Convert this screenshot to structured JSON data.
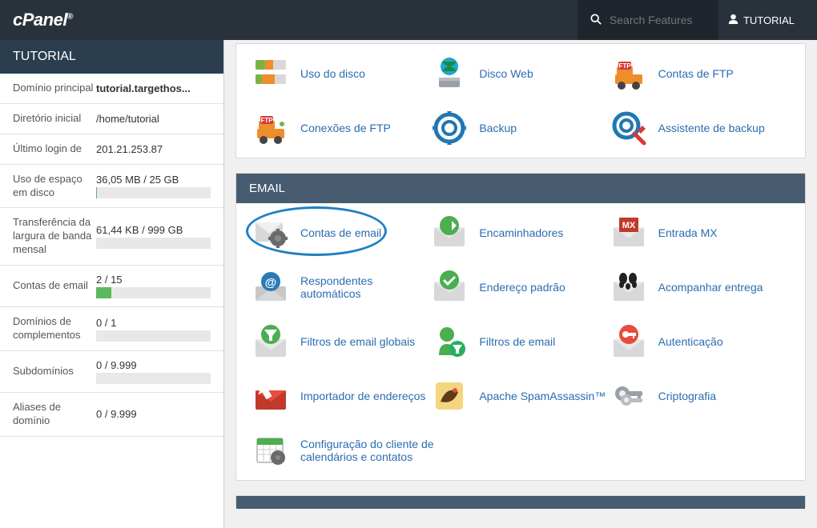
{
  "header": {
    "logo_text": "cPanel",
    "search_placeholder": "Search Features",
    "user_label": "TUTORIAL"
  },
  "sidebar": {
    "title": "TUTORIAL",
    "stats": {
      "primary_domain_label": "Domínio principal",
      "primary_domain_value": "tutorial.targethos...",
      "home_dir_label": "Diretório inicial",
      "home_dir_value": "/home/tutorial",
      "last_login_label": "Último login de",
      "last_login_value": "201.21.253.87",
      "disk_label": "Uso de espaço em disco",
      "disk_value": "36,05 MB / 25 GB",
      "disk_pct": 1,
      "bw_label": "Transferência da largura de banda mensal",
      "bw_value": "61,44 KB / 999 GB",
      "bw_pct": 0,
      "email_label": "Contas de email",
      "email_value": "2 / 15",
      "email_pct": 13,
      "addon_label": "Domínios de complementos",
      "addon_value": "0 / 1",
      "addon_pct": 0,
      "sub_label": "Subdomínios",
      "sub_value": "0 / 9.999",
      "sub_pct": 0,
      "alias_label": "Aliases de domínio",
      "alias_value": "0 / 9.999",
      "alias_pct": 0
    }
  },
  "sections": {
    "files_items": {
      "disk_usage": "Uso do disco",
      "web_disk": "Disco Web",
      "ftp_accounts": "Contas de FTP",
      "ftp_connections": "Conexões de FTP",
      "backup": "Backup",
      "backup_wizard": "Assistente de backup"
    },
    "email_title": "EMAIL",
    "email_items": {
      "email_accounts": "Contas de email",
      "forwarders": "Encaminhadores",
      "mx_entry": "Entrada MX",
      "autoresponders": "Respondentes automáticos",
      "default_address": "Endereço padrão",
      "track_delivery": "Acompanhar entrega",
      "global_filters": "Filtros de email globais",
      "email_filters": "Filtros de email",
      "authentication": "Autenticação",
      "address_importer": "Importador de endereços",
      "spamassassin": "Apache SpamAssassin™",
      "encryption": "Criptografia",
      "calendar_config": "Configuração do cliente de calendários e contatos"
    }
  }
}
